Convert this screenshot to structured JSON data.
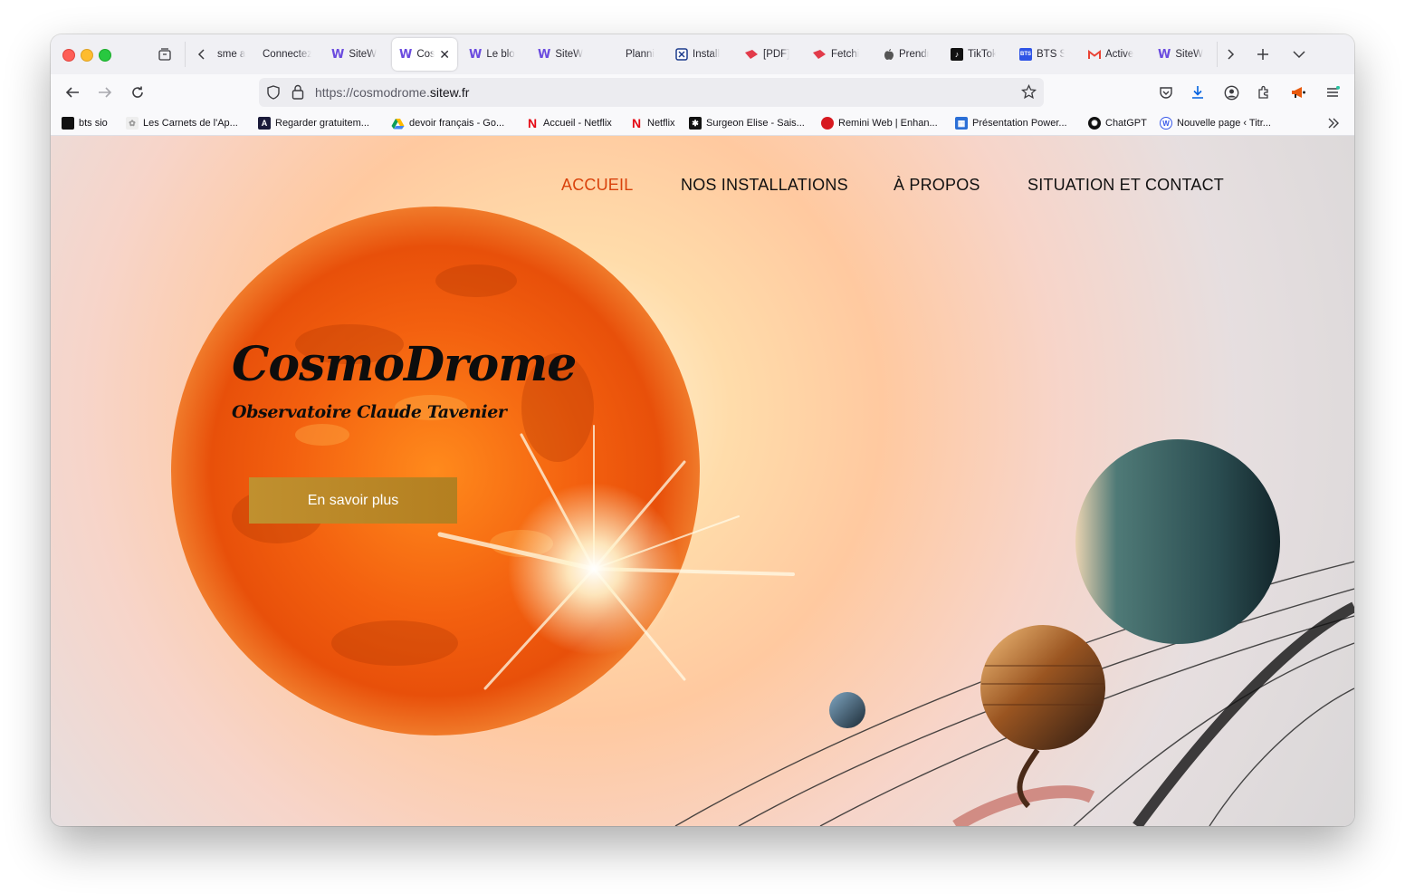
{
  "browser": {
    "tabs": [
      {
        "label": "sme a",
        "icon": "none"
      },
      {
        "label": "Connectez",
        "icon": "none"
      },
      {
        "label": "SiteW",
        "icon": "sitew-icon"
      },
      {
        "label": "Cos",
        "icon": "sitew-icon",
        "active": true
      },
      {
        "label": "Le blo",
        "icon": "sitew-icon"
      },
      {
        "label": "SiteW",
        "icon": "sitew-icon"
      },
      {
        "label": "Planni",
        "icon": "none"
      },
      {
        "label": "Install",
        "icon": "app-icon"
      },
      {
        "label": "[PDF]",
        "icon": "pdf-icon"
      },
      {
        "label": "Fetchi",
        "icon": "pdf-icon"
      },
      {
        "label": "Prendr",
        "icon": "apple-icon"
      },
      {
        "label": "TikTok",
        "icon": "tiktok-icon"
      },
      {
        "label": "BTS S",
        "icon": "bts-icon"
      },
      {
        "label": "Active",
        "icon": "gmail-icon"
      },
      {
        "label": "SiteW",
        "icon": "sitew-icon"
      }
    ],
    "url": {
      "prefix": "https://cosmodrome.",
      "host": "sitew.fr"
    },
    "bookmarks": [
      {
        "label": "bts  sio"
      },
      {
        "label": "Les Carnets de l'Ap..."
      },
      {
        "label": "Regarder gratuitem..."
      },
      {
        "label": "devoir français - Go..."
      },
      {
        "label": "Accueil - Netflix"
      },
      {
        "label": "Netflix"
      },
      {
        "label": "Surgeon Elise - Sais..."
      },
      {
        "label": "Remini Web | Enhan..."
      },
      {
        "label": "Présentation Power..."
      },
      {
        "label": "ChatGPT"
      },
      {
        "label": "Nouvelle page ‹ Titr..."
      }
    ]
  },
  "site": {
    "nav": {
      "accueil": "ACCUEIL",
      "installations": "NOS INSTALLATIONS",
      "apropos": "À PROPOS",
      "contact": "SITUATION ET CONTACT"
    },
    "hero": {
      "title": "CosmoDrome",
      "subtitle": "Observatoire Claude Tavenier",
      "cta": "En savoir plus"
    },
    "colors": {
      "accent": "#d9420c",
      "cta": "#b9862a"
    }
  }
}
